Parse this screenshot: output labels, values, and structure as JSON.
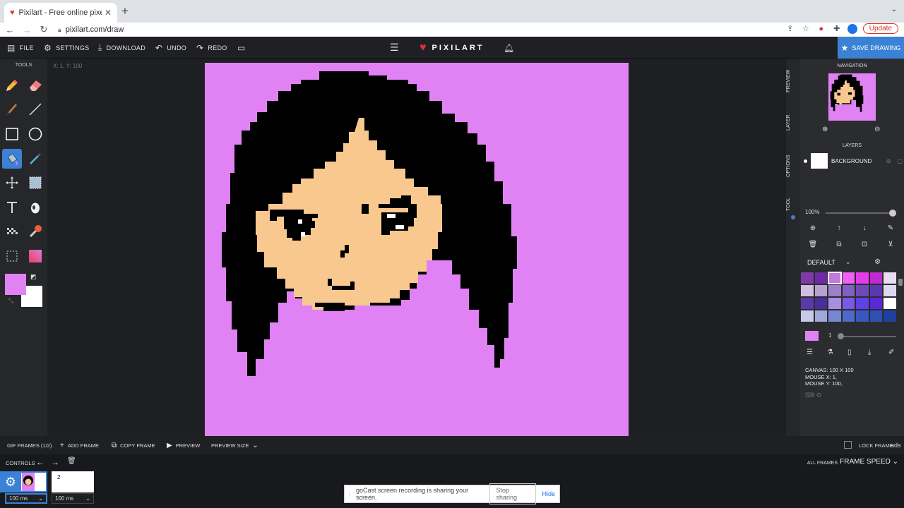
{
  "browser": {
    "tab_title": "Pixilart - Free online pixel art d",
    "url": "pixilart.com/draw",
    "update_label": "Update"
  },
  "toolbar": {
    "file": "FILE",
    "settings": "SETTINGS",
    "download": "DOWNLOAD",
    "undo": "UNDO",
    "redo": "REDO",
    "brand": "PIXILART",
    "save": "SAVE DRAWING"
  },
  "tools": {
    "title": "TOOLS",
    "primary_color": "#e082f3",
    "secondary_color": "#ffffff",
    "active_tool": "bucket-fill"
  },
  "workspace": {
    "coords": "X: 1, Y: 100",
    "canvas_bg": "#e082f3"
  },
  "side_tabs": [
    "PREVIEW",
    "LAYER",
    "OPTIONS",
    "TOOL"
  ],
  "navigation": {
    "title": "NAVIGATION"
  },
  "layers": {
    "title": "LAYERS",
    "items": [
      {
        "name": "BACKGROUND"
      }
    ],
    "opacity": "100%"
  },
  "palette": {
    "name": "DEFAULT",
    "colors": [
      "#7d3aa8",
      "#6a2ca0",
      "#c478e0",
      "#f060f2",
      "#e33ce8",
      "#c02ad0",
      "#e8def0",
      "#d0c0e0",
      "#b8a0d0",
      "#a080c8",
      "#8060c0",
      "#7048b8",
      "#5c38b0",
      "#e0d8f0",
      "#5a3aa8",
      "#4a2e98",
      "#a890e0",
      "#7a58e8",
      "#6040e8",
      "#5a28d8",
      "#ffffff",
      "#c8c8e8",
      "#a0a8d8",
      "#7888d0",
      "#5068c8",
      "#3858c0",
      "#3050b0",
      "#2040a0"
    ],
    "brush_size": "1"
  },
  "info": {
    "canvas": "CANVAS: 100 X 100",
    "mouse_x": "MOUSE X: 1,",
    "mouse_y": "MOUSE Y: 100,"
  },
  "frames": {
    "gif_frames": "GIF FRAMES (1/2)",
    "add_frame": "ADD FRAME",
    "copy_frame": "COPY FRAME",
    "preview": "PREVIEW",
    "preview_size": "PREVIEW SIZE",
    "lock_frame": "LOCK FRAME",
    "ads": "ads",
    "controls": "CONTROLS",
    "all_frames": "ALL FRAMES",
    "frame_speed": "FRAME SPEED",
    "items": [
      {
        "label": "",
        "speed": "100 ms"
      },
      {
        "label": "2",
        "speed": "100 ms"
      }
    ]
  },
  "share_notice": {
    "text": "goCast screen recording is sharing your screen.",
    "stop": "Stop sharing",
    "hide": "Hide"
  }
}
